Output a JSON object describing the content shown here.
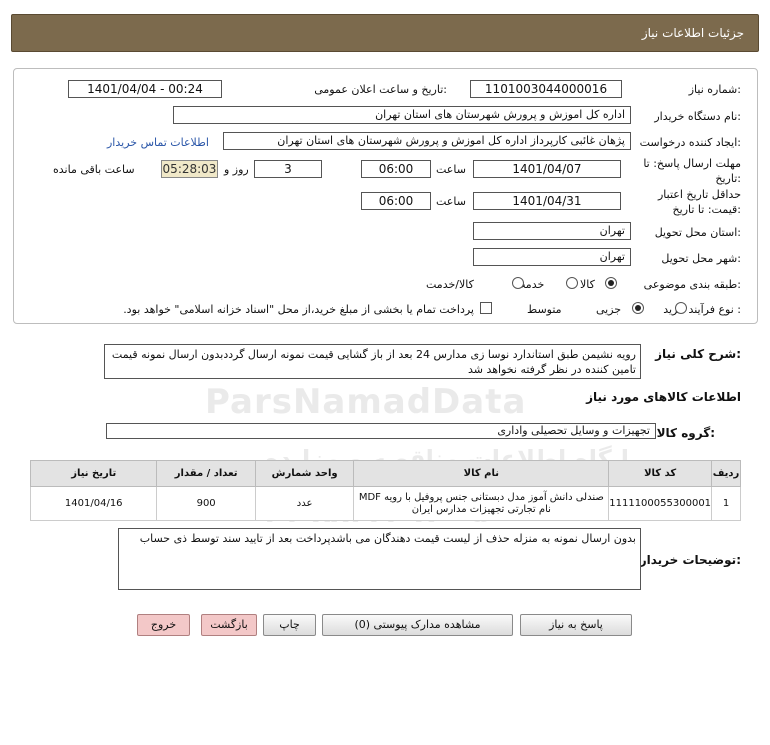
{
  "header": {
    "title": "جزئیات اطلاعات نیاز"
  },
  "form": {
    "need_number_label": "شماره نیاز:",
    "need_number": "1101003044000016",
    "announce_label": "تاریخ و ساعت اعلان عمومی:",
    "announce_value": "1401/04/04 - 00:24",
    "buyer_org_label": "نام دستگاه خریدار:",
    "buyer_org": "اداره کل اموزش و پرورش شهرستان های استان تهران",
    "requester_label": "ایجاد کننده درخواست:",
    "requester": "پژهان غائبی کارپرداز اداره کل اموزش و پرورش شهرستان های استان تهران",
    "contact_link": "اطلاعات تماس خریدار",
    "deadline_label_1": "مهلت ارسال پاسخ: تا",
    "deadline_label_2": "تاریخ:",
    "deadline_date": "1401/04/07",
    "time_label": "ساعت",
    "deadline_time": "06:00",
    "day_label": "روز و",
    "days": "3",
    "remaining_time": "05:28:03",
    "remaining_label": "ساعت باقی مانده",
    "validity_label_1": "حداقل تاریخ اعتبار",
    "validity_label_2": "قیمت: تا تاریخ:",
    "validity_date": "1401/04/31",
    "validity_time": "06:00",
    "province_label": "استان محل تحویل:",
    "province": "تهران",
    "city_label": "شهر محل تحویل:",
    "city": "تهران",
    "category_label": "طبقه بندی موضوعی:",
    "category_options": [
      "کالا",
      "خدمت",
      "کالا/خدمت"
    ],
    "category_selected": "کالا",
    "process_label": "نوع فرآیند خرید :",
    "process_options": [
      "جزیی",
      "متوسط"
    ],
    "process_selected": "متوسط",
    "payment_note": "پرداخت تمام یا بخشی از مبلغ خرید،از محل \"اسناد خزانه اسلامی\" خواهد بود."
  },
  "description": {
    "label": "شرح کلی نیاز:",
    "text": "رویه نشیمن طبق استاندارد نوسا زی مدارس 24 بعد از باز گشایی قیمت نمونه ارسال گرددبدون ارسال نمونه قیمت تامین کننده در نظر گرفته نخواهد شد"
  },
  "goods": {
    "section_title": "اطلاعات کالاهای مورد نیاز",
    "group_label": "گروه کالا:",
    "group_value": "تجهیزات و وسایل تحصیلی واداری",
    "columns": [
      "ردیف",
      "کد کالا",
      "نام کالا",
      "واحد شمارش",
      "تعداد / مقدار",
      "تاریخ نیاز"
    ],
    "rows": [
      {
        "row": "1",
        "code": "1111100055300001",
        "name_line1": "صندلی دانش آموز مدل دبستانی جنس پروفیل با رویه MDF",
        "name_line2": "نام تجارتی تجهیزات مدارس ایران",
        "unit": "عدد",
        "qty": "900",
        "date": "1401/04/16"
      }
    ]
  },
  "buyer_notes": {
    "label": "توضیحات خریدار:",
    "text": "بدون ارسال نمونه  به منزله حذف از لیست قیمت دهندگان می باشدپرداخت بعد از تایید سند توسط ذی حساب"
  },
  "buttons": {
    "reply": "پاسخ به نیاز",
    "attachments": "مشاهده مدارک پیوستی (0)",
    "print": "چاپ",
    "back": "بازگشت",
    "exit": "خروج"
  },
  "watermark": {
    "brand": "ParsNamadData",
    "slogan": "پایگاه اطلاعات مناقصه و مزایده",
    "phone": "۰۲۱-۸۸۳۴۶۹۷۰-۵"
  }
}
